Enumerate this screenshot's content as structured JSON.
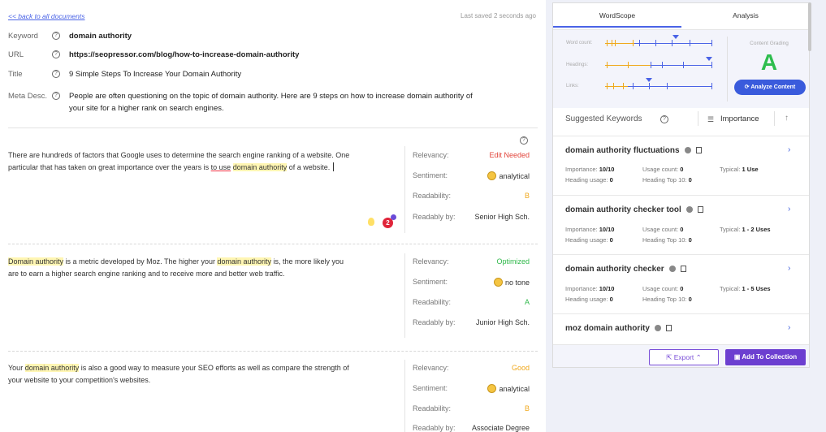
{
  "editor": {
    "back_link": "<< back to all documents",
    "last_saved": "Last saved 2 seconds ago",
    "meta": {
      "keyword_label": "Keyword",
      "keyword": "domain authority",
      "url_label": "URL",
      "url": "https://seopressor.com/blog/how-to-increase-domain-authority",
      "title_label": "Title",
      "title": "9 Simple Steps To Increase Your Domain Authority",
      "desc_label": "Meta Desc.",
      "desc_line1": "People are often questioning on the topic of domain authority. Here are 9 steps on how to increase domain authority of",
      "desc_line2": "your site for a higher rank on search engines."
    },
    "paragraphs": [
      {
        "line1": "There are hundreds of factors that Google uses to determine the search engine ranking of a website. One",
        "line2_a": "particular that has taken on great importance over the years is ",
        "line2_b": "to use",
        "line2_c": " ",
        "line2_d": "domain authority",
        "line2_e": " of a website.",
        "relevancy_label": "Relevancy:",
        "relevancy": "Edit Needed",
        "sentiment_label": "Sentiment:",
        "sentiment": "analytical",
        "readability_label": "Readability:",
        "readability": "B",
        "readably_label": "Readably by:",
        "readably": "Senior High Sch.",
        "badge_count": "2"
      },
      {
        "line1_a": "Domain authority",
        "line1_b": " is a metric developed by Moz. The higher your ",
        "line1_c": "domain authority",
        "line1_d": " is, the more likely you",
        "line2": "are to earn a higher search engine ranking and to receive more and better web traffic.",
        "relevancy_label": "Relevancy:",
        "relevancy": "Optimized",
        "sentiment_label": "Sentiment:",
        "sentiment": "no tone",
        "readability_label": "Readability:",
        "readability": "A",
        "readably_label": "Readably by:",
        "readably": "Junior High Sch."
      },
      {
        "line1_a": "Your ",
        "line1_b": "domain authority",
        "line1_c": " is also a good way to measure your SEO efforts as well as compare the strength of",
        "line2": "your website to your competition's websites.",
        "relevancy_label": "Relevancy:",
        "relevancy": "Good",
        "sentiment_label": "Sentiment:",
        "sentiment": "analytical",
        "readability_label": "Readability:",
        "readability": "B",
        "readably_label": "Readably by:",
        "readably": "Associate Degree"
      }
    ]
  },
  "panel": {
    "tabs": [
      "WordScope",
      "Analysis"
    ],
    "scope": {
      "word_count_label": "Word count:",
      "headings_label": "Headings:",
      "links_label": "Links:",
      "grading_label": "Content Grading",
      "grade": "A",
      "analyze_label": "Analyze Content"
    },
    "suggested": {
      "title": "Suggested Keywords",
      "sort_label": "Importance",
      "keywords": [
        {
          "name": "domain authority fluctuations",
          "importance": "10/10",
          "usage": "0",
          "typical": "1 Use",
          "heading": "0",
          "top10": "0"
        },
        {
          "name": "domain authority checker tool",
          "importance": "10/10",
          "usage": "0",
          "typical": "1 - 2 Uses",
          "heading": "0",
          "top10": "0"
        },
        {
          "name": "domain authority checker",
          "importance": "10/10",
          "usage": "0",
          "typical": "1 - 5 Uses",
          "heading": "0",
          "top10": "0"
        },
        {
          "name": "moz domain authority"
        }
      ],
      "labels": {
        "importance": "Importance:",
        "usage": "Usage count:",
        "typical": "Typical:",
        "heading": "Heading usage:",
        "top10": "Heading Top 10:"
      }
    },
    "footer": {
      "export_label": "Export",
      "collection_label": "Add To Collection"
    }
  },
  "colors": {
    "accent": "#4a63e6",
    "grade": "#2ebd4e",
    "purple": "#6c3fd0",
    "warning": "#f0a81c",
    "error": "#e2443a"
  }
}
